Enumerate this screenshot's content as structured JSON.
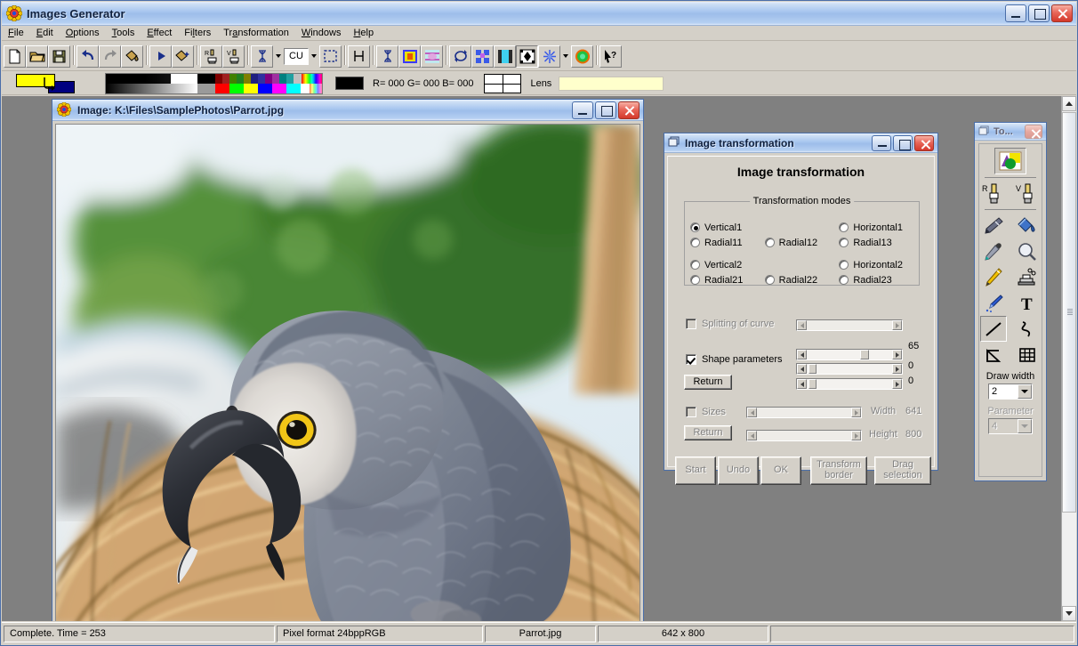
{
  "app": {
    "title": "Images Generator",
    "icon": "app-flower-icon",
    "window_buttons": {
      "minimize": "_",
      "maximize": "□",
      "close": "✕"
    }
  },
  "menu": {
    "items": [
      {
        "label": "File",
        "mnemonic": "F"
      },
      {
        "label": "Edit",
        "mnemonic": "E"
      },
      {
        "label": "Options",
        "mnemonic": "O"
      },
      {
        "label": "Tools",
        "mnemonic": "T"
      },
      {
        "label": "Effect",
        "mnemonic": "E"
      },
      {
        "label": "Filters",
        "mnemonic": "l"
      },
      {
        "label": "Transformation",
        "mnemonic": "a"
      },
      {
        "label": "Windows",
        "mnemonic": "W"
      },
      {
        "label": "Help",
        "mnemonic": "H"
      }
    ]
  },
  "toolbar": {
    "buttons": [
      {
        "name": "new-file-icon",
        "glyph": "new"
      },
      {
        "name": "open-file-icon",
        "glyph": "open"
      },
      {
        "name": "save-file-icon",
        "glyph": "save"
      },
      {
        "name": "undo-icon",
        "glyph": "undo"
      },
      {
        "name": "redo-icon",
        "glyph": "redo"
      },
      {
        "name": "paint-bucket-icon",
        "glyph": "bucket"
      },
      {
        "name": "play-icon",
        "glyph": "play"
      },
      {
        "name": "bucket-star-icon",
        "glyph": "bucket2"
      },
      {
        "name": "ra-stamp-icon",
        "glyph": "ra"
      },
      {
        "name": "va-stamp-icon",
        "glyph": "va"
      },
      {
        "name": "text-cursor-icon",
        "glyph": "ibeam"
      },
      {
        "name": "selection-rect-icon",
        "glyph": "marquee"
      },
      {
        "name": "horizontal-measure-icon",
        "glyph": "hbar"
      },
      {
        "name": "text-cursor2-icon",
        "glyph": "ibeam2"
      },
      {
        "name": "color-square-icon",
        "glyph": "csq"
      },
      {
        "name": "gradient-icon",
        "glyph": "grad"
      },
      {
        "name": "refresh-icon",
        "glyph": "refresh"
      },
      {
        "name": "pattern-icon",
        "glyph": "pattern"
      },
      {
        "name": "blend-icon",
        "glyph": "blend"
      },
      {
        "name": "transform-icon",
        "glyph": "xform"
      },
      {
        "name": "snowflake-icon",
        "glyph": "snow"
      },
      {
        "name": "orb-icon",
        "glyph": "orb"
      },
      {
        "name": "help-pointer-icon",
        "glyph": "helpptr"
      }
    ],
    "cu_label": "CU"
  },
  "colorbar": {
    "foreground_color": "#ffff00",
    "background_color": "#000080",
    "current_swatch": "#000000",
    "rgb_readout": "R= 000  G= 000  B= 000",
    "lens_label": "Lens",
    "lens_color": "#ffffcc"
  },
  "image_window": {
    "title": "Image: K:\\Files\\SamplePhotos\\Parrot.jpg",
    "icon": "app-flower-icon",
    "subject": "african-grey-parrot-photo"
  },
  "transform_dialog": {
    "titlebar": "Image transformation",
    "heading": "Image transformation",
    "group_label": "Transformation modes",
    "modes": [
      {
        "label": "Vertical1",
        "selected": true
      },
      {
        "label": "",
        "selected": false,
        "empty": true
      },
      {
        "label": "Horizontal1",
        "selected": false
      },
      {
        "label": "Radial11",
        "selected": false
      },
      {
        "label": "Radial12",
        "selected": false
      },
      {
        "label": "Radial13",
        "selected": false
      },
      {
        "label": "Vertical2",
        "selected": false
      },
      {
        "label": "",
        "selected": false,
        "empty": true
      },
      {
        "label": "Horizontal2",
        "selected": false
      },
      {
        "label": "Radial21",
        "selected": false
      },
      {
        "label": "Radial22",
        "selected": false
      },
      {
        "label": "Radial23",
        "selected": false
      }
    ],
    "splitting": {
      "label": "Splitting of curve",
      "checked": false,
      "enabled": false,
      "slider_pos": 0
    },
    "shape": {
      "label": "Shape parameters",
      "checked": true,
      "enabled": true,
      "return_label": "Return",
      "sliders": [
        {
          "value": "65",
          "pos": 65
        },
        {
          "value": "0",
          "pos": 0
        },
        {
          "value": "0",
          "pos": 0
        }
      ]
    },
    "sizes": {
      "label": "Sizes",
      "checked": false,
      "enabled": false,
      "return_label": "Return",
      "width_label": "Width",
      "width_value": "641",
      "height_label": "Height",
      "height_value": "800"
    },
    "buttons": [
      {
        "label": "Start",
        "enabled": false
      },
      {
        "label": "Undo",
        "enabled": false
      },
      {
        "label": "OK",
        "enabled": false
      },
      {
        "label": "Transform border",
        "enabled": false
      },
      {
        "label": "Drag selection",
        "enabled": false
      }
    ]
  },
  "tools_palette": {
    "title": "To...",
    "selected_tool": "line-tool",
    "rows": [
      {
        "tools": [
          {
            "name": "shapes-color-icon",
            "selected": true
          }
        ]
      },
      {
        "tools": [
          {
            "name": "ra-brush-icon"
          },
          {
            "name": "va-brush-icon"
          }
        ]
      },
      {
        "tools": [
          {
            "name": "airbrush-icon"
          },
          {
            "name": "paint-bucket-icon"
          }
        ]
      },
      {
        "tools": [
          {
            "name": "eyedropper-icon"
          },
          {
            "name": "magnifier-icon"
          }
        ]
      },
      {
        "tools": [
          {
            "name": "pencil-icon"
          },
          {
            "name": "stamp-icon"
          }
        ]
      },
      {
        "tools": [
          {
            "name": "brush-icon"
          },
          {
            "name": "text-tool-icon"
          }
        ]
      },
      {
        "tools": [
          {
            "name": "line-tool-icon",
            "selected": true
          },
          {
            "name": "curve-tool-icon"
          }
        ]
      },
      {
        "tools": [
          {
            "name": "polygon-tool-icon"
          },
          {
            "name": "grid-tool-icon"
          }
        ]
      }
    ],
    "draw_width": {
      "label": "Draw width",
      "value": "2",
      "enabled": true
    },
    "parameter": {
      "label": "Parameter",
      "value": "4",
      "enabled": false
    }
  },
  "statusbar": {
    "cells": [
      {
        "text": "Complete.  Time = 253",
        "align": "left"
      },
      {
        "text": "Pixel format 24bppRGB",
        "align": "left"
      },
      {
        "text": "Parrot.jpg",
        "align": "center"
      },
      {
        "text": "642 x 800",
        "align": "center"
      },
      {
        "text": "",
        "align": "center"
      }
    ]
  },
  "workspace": {
    "background_color": "#808080"
  }
}
